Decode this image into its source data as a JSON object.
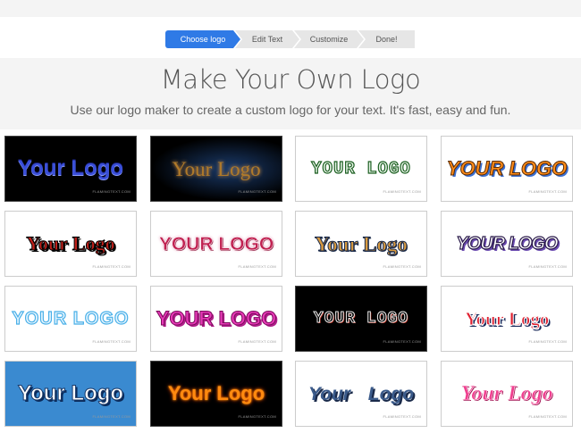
{
  "steps": [
    "Choose logo",
    "Edit Text",
    "Customize",
    "Done!"
  ],
  "active_step": "Choose logo",
  "title": "Make Your Own Logo",
  "subtitle": "Use our logo maker to create a custom logo for your text. It's fast, easy and fun.",
  "logos": [
    {
      "text": "Your Logo",
      "watermark": "FLAMINGTEXT.COM"
    },
    {
      "text": "Your Logo",
      "watermark": "FLAMINGTEXT.COM"
    },
    {
      "text": "YOUR LOGO",
      "watermark": "FLAMINGTEXT.COM"
    },
    {
      "text": "YOUR LOGO",
      "watermark": "FLAMINGTEXT.COM"
    },
    {
      "text": "Your Logo",
      "watermark": "FLAMINGTEXT.COM"
    },
    {
      "text": "YOUR LOGO",
      "watermark": "FLAMINGTEXT.COM"
    },
    {
      "text": "Your Logo",
      "watermark": "FLAMINGTEXT.COM"
    },
    {
      "text": "YOUR LOGO",
      "watermark": "FLAMINGTEXT.COM"
    },
    {
      "text": "YOUR LOGO",
      "watermark": "FLAMINGTEXT.COM"
    },
    {
      "text": "YOUR LOGO",
      "watermark": "FLAMINGTEXT.COM"
    },
    {
      "text": "YOUR LOGO",
      "watermark": "FLAMINGTEXT.COM"
    },
    {
      "text": "Your Logo",
      "watermark": "FLAMINGTEXT.COM"
    },
    {
      "text": "Your Logo",
      "watermark": "FLAMINGTEXT.COM"
    },
    {
      "text": "Your Logo",
      "watermark": "FLAMINGTEXT.COM"
    },
    {
      "text": "Your Logo",
      "watermark": "FLAMINGTEXT.COM"
    },
    {
      "text": "Your Logo",
      "watermark": "FLAMINGTEXT.COM"
    }
  ],
  "colors": {
    "accent": "#2f7ae6",
    "step_inactive": "#e6e6e6",
    "hero_bg": "#f4f4f4"
  }
}
